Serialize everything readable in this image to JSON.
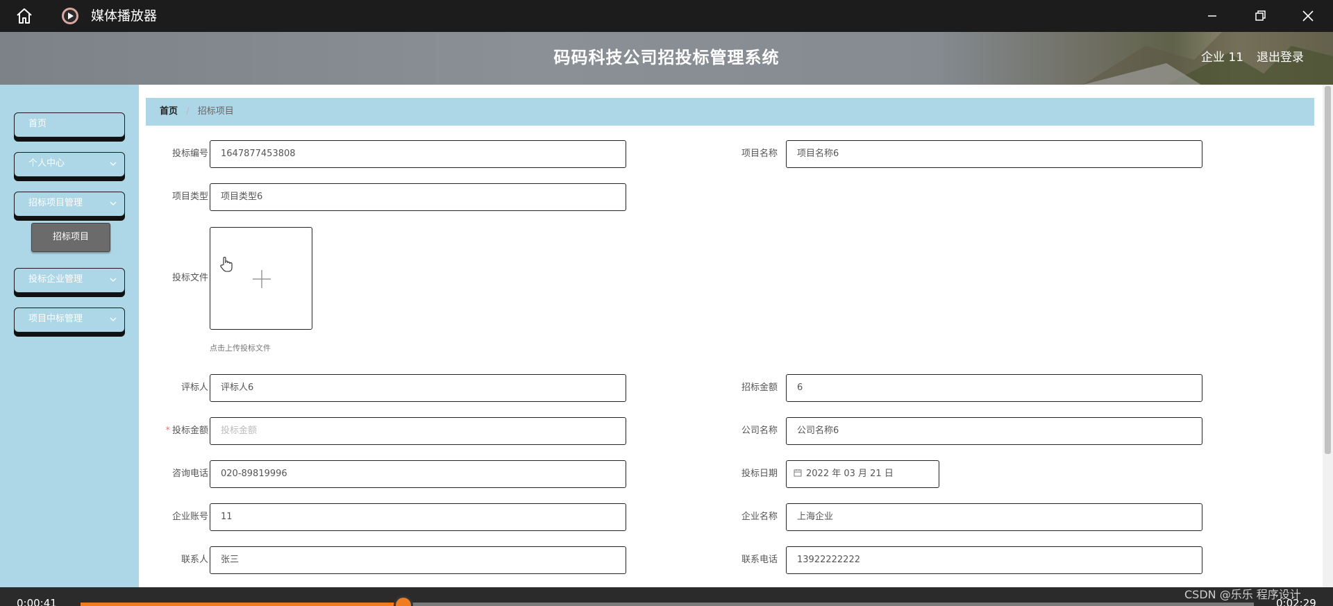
{
  "titlebar": {
    "app_title": "媒体播放器"
  },
  "header": {
    "title": "码码科技公司招投标管理系统",
    "user": "企业 11",
    "logout": "退出登录"
  },
  "sidebar": {
    "items": [
      {
        "label": "首页"
      },
      {
        "label": "个人中心"
      },
      {
        "label": "招标项目管理"
      },
      {
        "label": "投标企业管理"
      },
      {
        "label": "项目中标管理"
      }
    ],
    "sub_item": "招标项目"
  },
  "breadcrumb": {
    "home": "首页",
    "separator": "/",
    "current": "招标项目"
  },
  "form": {
    "bid_no": {
      "label": "投标编号",
      "value": "1647877453808"
    },
    "project_name": {
      "label": "项目名称",
      "value": "项目名称6"
    },
    "project_type": {
      "label": "项目类型",
      "value": "项目类型6"
    },
    "bid_file": {
      "label": "投标文件",
      "tip": "点击上传投标文件"
    },
    "reviewer": {
      "label": "评标人",
      "value": "评标人6"
    },
    "tender_amount": {
      "label": "招标金额",
      "value": "6"
    },
    "bid_amount": {
      "required": "*",
      "label": "投标金额",
      "placeholder": "投标金额"
    },
    "company_name": {
      "label": "公司名称",
      "value": "公司名称6"
    },
    "phone": {
      "label": "咨询电话",
      "value": "020-89819996"
    },
    "bid_date": {
      "label": "投标日期",
      "value": "2022 年 03 月 21 日"
    },
    "account": {
      "label": "企业账号",
      "value": "11"
    },
    "enterprise_name": {
      "label": "企业名称",
      "value": "上海企业"
    },
    "contact": {
      "label": "联系人",
      "value": "张三"
    },
    "contact_phone": {
      "label": "联系电话",
      "value": "13922222222"
    }
  },
  "player": {
    "elapsed": "0:00:41",
    "total": "0:02:29",
    "progress_fraction": 0.275
  },
  "watermark": "CSDN @乐乐 程序设计",
  "colors": {
    "sidebar": "#add6e6",
    "accent": "#f07c1f",
    "titlebar": "#1c1c1c"
  }
}
